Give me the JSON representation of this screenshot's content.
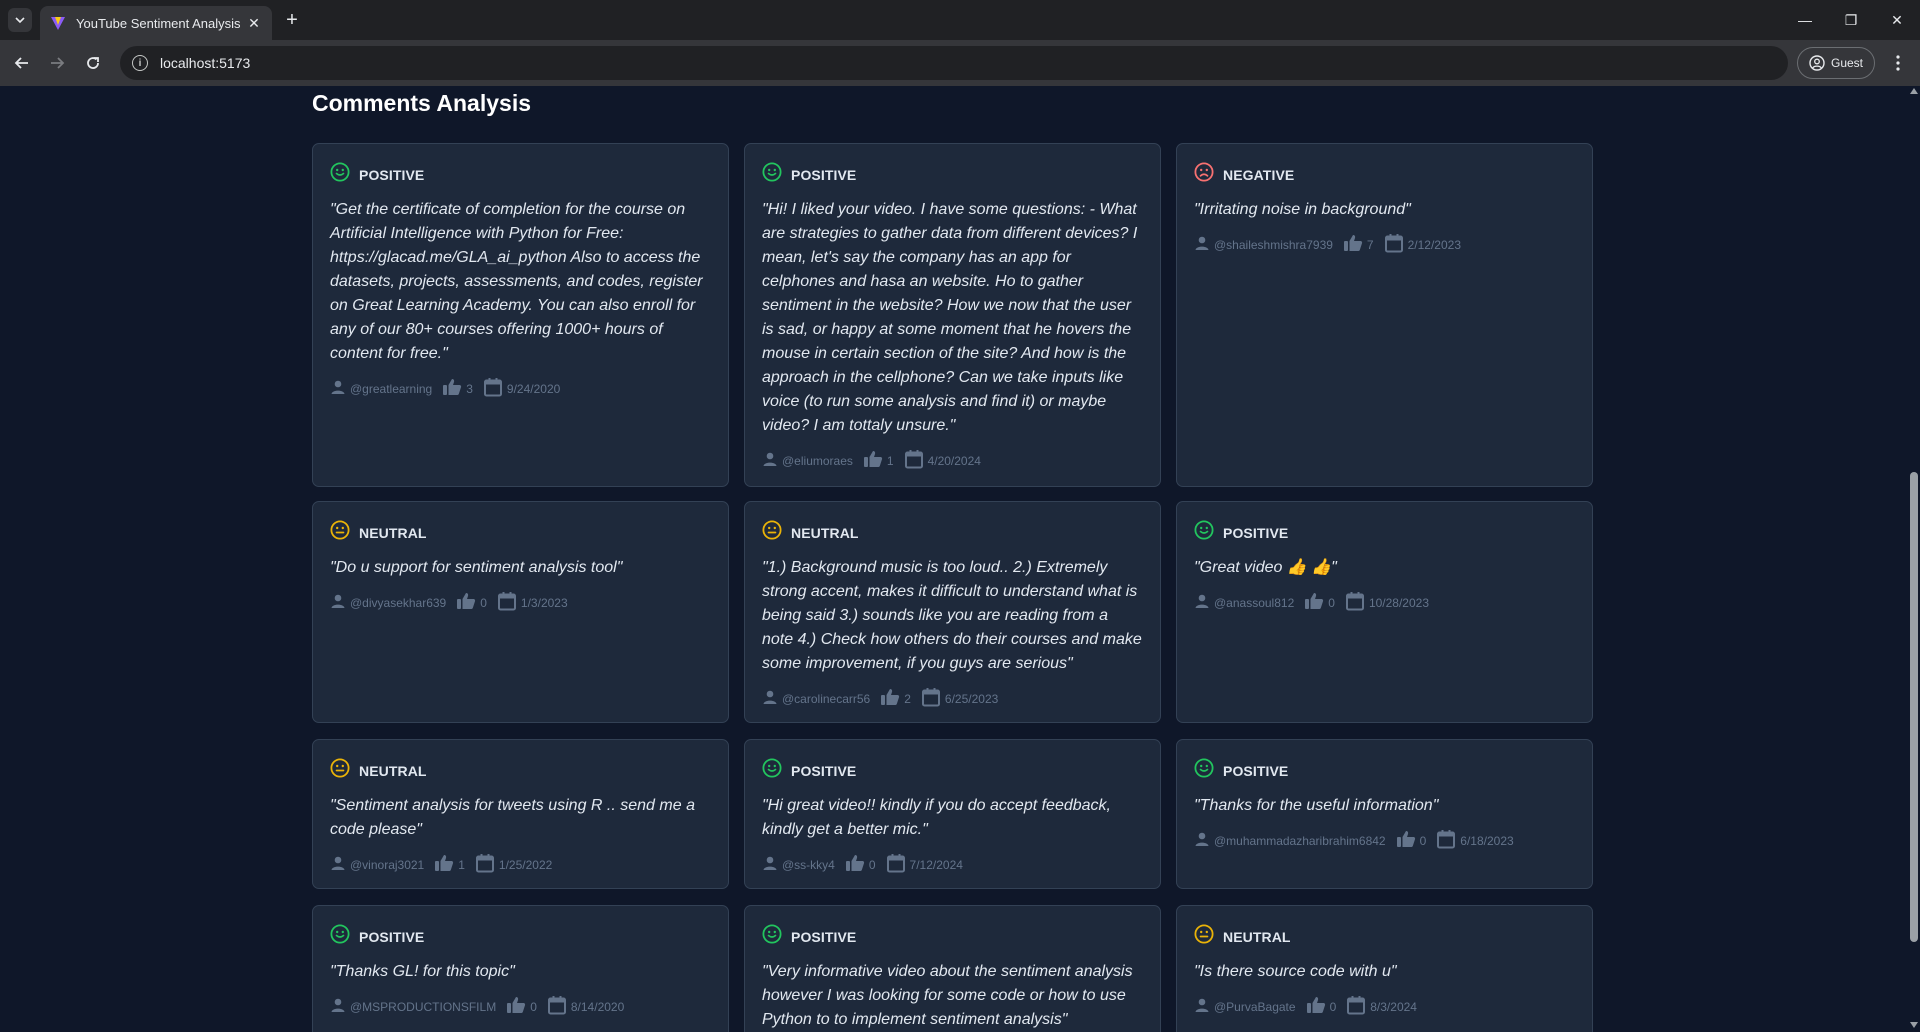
{
  "browser": {
    "tab_title": "YouTube Sentiment Analysis",
    "url": "localhost:5173",
    "profile_label": "Guest"
  },
  "colors": {
    "positive": "#22c55e",
    "neutral": "#eab308",
    "negative": "#f87171"
  },
  "section": {
    "title": "Comments Analysis"
  },
  "comments": [
    {
      "sentiment": "POSITIVE",
      "text": "\"Get the certificate of completion for the course on Artificial Intelligence with Python for Free: https://glacad.me/GLA_ai_python Also to access the datasets, projects, assessments, and codes, register on Great Learning Academy. You can also enroll for any of our 80+ courses offering 1000+ hours of content for free.\"",
      "author": "@greatlearning",
      "likes": "3",
      "date": "9/24/2020"
    },
    {
      "sentiment": "POSITIVE",
      "text": "\"Hi! I liked your video. I have some questions: - What are strategies to gather data from different devices? I mean, let's say the company has an app for celphones and hasa an website. Ho to gather sentiment in the website? How we now that the user is sad, or happy at some moment that he hovers the mouse in certain section of the site? And how is the approach in the cellphone? Can we take inputs like voice (to run some analysis and find it) or maybe video? I am tottaly unsure.\"",
      "author": "@eliumoraes",
      "likes": "1",
      "date": "4/20/2024"
    },
    {
      "sentiment": "NEGATIVE",
      "text": "\"Irritating noise in background\"",
      "author": "@shaileshmishra7939",
      "likes": "7",
      "date": "2/12/2023"
    },
    {
      "sentiment": "NEUTRAL",
      "text": "\"Do u support for sentiment analysis tool\"",
      "author": "@divyasekhar639",
      "likes": "0",
      "date": "1/3/2023"
    },
    {
      "sentiment": "NEUTRAL",
      "text": "\"1.) Background music is too loud.. 2.) Extremely strong accent, makes it difficult to understand what is being said 3.) sounds like you are reading from a note 4.) Check how others do their courses and make some improvement, if you guys are serious\"",
      "author": "@carolinecarr56",
      "likes": "2",
      "date": "6/25/2023"
    },
    {
      "sentiment": "POSITIVE",
      "text": "\"Great video 👍 👍\"",
      "author": "@anassoul812",
      "likes": "0",
      "date": "10/28/2023"
    },
    {
      "sentiment": "NEUTRAL",
      "text": "\"Sentiment analysis for tweets using R .. send me a code please\"",
      "author": "@vinoraj3021",
      "likes": "1",
      "date": "1/25/2022"
    },
    {
      "sentiment": "POSITIVE",
      "text": "\"Hi great video!! kindly if you do accept feedback, kindly get a better mic.\"",
      "author": "@ss-kky4",
      "likes": "0",
      "date": "7/12/2024"
    },
    {
      "sentiment": "POSITIVE",
      "text": "\"Thanks for the useful information\"",
      "author": "@muhammadazharibrahim6842",
      "likes": "0",
      "date": "6/18/2023"
    },
    {
      "sentiment": "POSITIVE",
      "text": "\"Thanks GL! for this topic\"",
      "author": "@MSPRODUCTIONSFILM",
      "likes": "0",
      "date": "8/14/2020"
    },
    {
      "sentiment": "POSITIVE",
      "text": "\"Very informative video about the sentiment analysis however I was looking for some code or how to use Python to to implement sentiment analysis\"",
      "author": "",
      "likes": "",
      "date": ""
    },
    {
      "sentiment": "NEUTRAL",
      "text": "\"Is there source code with u\"",
      "author": "@PurvaBagate",
      "likes": "0",
      "date": "8/3/2024"
    }
  ]
}
